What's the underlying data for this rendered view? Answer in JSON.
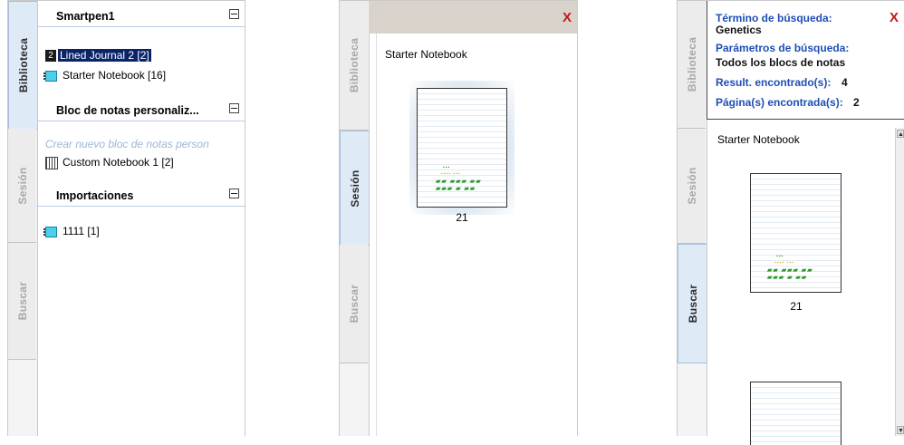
{
  "tabs": {
    "library": "Biblioteca",
    "session": "Sesión",
    "search": "Buscar"
  },
  "panel1": {
    "section1": {
      "title": "Smartpen1",
      "items": [
        {
          "icon_text": "2",
          "label": "Lined Journal 2 [2]",
          "selected": true
        },
        {
          "label": "Starter Notebook [16]"
        }
      ]
    },
    "section2": {
      "title": "Bloc de notas personaliz...",
      "create_placeholder": "Crear nuevo bloc de notas person",
      "items": [
        {
          "label": "Custom Notebook 1 [2]"
        }
      ]
    },
    "section3": {
      "title": "Importaciones",
      "items": [
        {
          "label": "1111 [1]"
        }
      ]
    }
  },
  "panel2": {
    "close": "X",
    "notebook_title": "Starter Notebook",
    "page_number": "21"
  },
  "panel3": {
    "close": "X",
    "search_term_label": "Término de búsqueda:",
    "search_term_value": "Genetics",
    "params_label": "Parámetros de búsqueda:",
    "params_value": "Todos los blocs de notas",
    "results_label": "Result. encontrado(s):",
    "results_value": "4",
    "pages_label": "Página(s) encontrada(s):",
    "pages_value": "2",
    "notebook_title": "Starter Notebook",
    "page_number": "21"
  },
  "colors": {
    "accent_blue": "#1f4fb5",
    "close_red": "#c51515",
    "selection": "#0a246a"
  }
}
